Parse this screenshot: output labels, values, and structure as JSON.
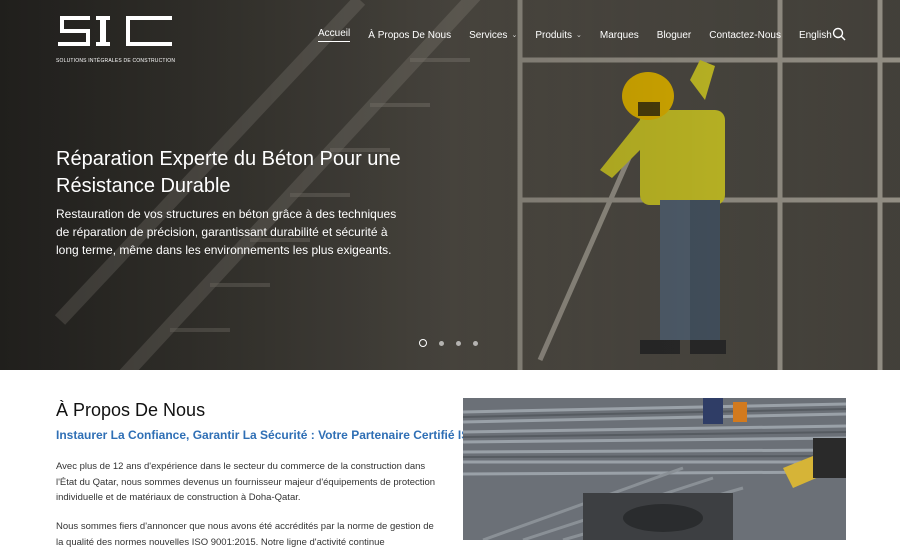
{
  "brand": {
    "letters": "SIC",
    "tagline": "SOLUTIONS INTÉGRALES DE CONSTRUCTION"
  },
  "nav": {
    "items": [
      {
        "label": "Accueil",
        "active": true,
        "dropdown": false
      },
      {
        "label": "À Propos De Nous",
        "active": false,
        "dropdown": false
      },
      {
        "label": "Services",
        "active": false,
        "dropdown": true
      },
      {
        "label": "Produits",
        "active": false,
        "dropdown": true
      },
      {
        "label": "Marques",
        "active": false,
        "dropdown": false
      },
      {
        "label": "Bloguer",
        "active": false,
        "dropdown": false
      },
      {
        "label": "Contactez-Nous",
        "active": false,
        "dropdown": false
      },
      {
        "label": "English",
        "active": false,
        "dropdown": false
      }
    ],
    "search_icon": "search-icon"
  },
  "hero": {
    "title": "Réparation Experte du Béton Pour une Résistance Durable",
    "text": "Restauration de vos structures en béton grâce à des techniques de réparation de précision, garantissant durabilité et sécurité à long terme, même dans les environnements les plus exigeants.",
    "slides": 4,
    "active_slide": 1
  },
  "about": {
    "title": "À Propos De Nous",
    "subtitle": "Instaurer La Confiance, Garantir La Sécurité : Votre Partenaire Certifié ISO",
    "p1": "Avec plus de 12 ans d'expérience dans le secteur du commerce de la construction dans l'État du Qatar, nous sommes devenus un fournisseur majeur d'équipements de protection individuelle et de matériaux de construction à Doha-Qatar.",
    "p2": "Nous sommes fiers d'annoncer que nous avons été accrédités par la norme de gestion de la qualité des normes nouvelles ISO 9001:2015. Notre ligne d'activité continue"
  },
  "colors": {
    "accent": "#2f6fb5",
    "helmet": "#f2c200",
    "vest": "#d9d22a"
  }
}
